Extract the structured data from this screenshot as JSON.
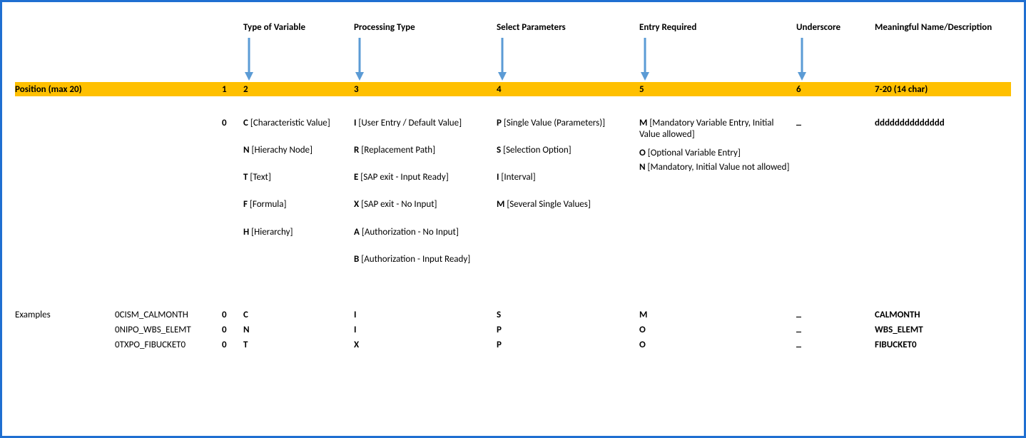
{
  "headers": {
    "type_of_variable": "Type of Variable",
    "processing_type": "Processing Type",
    "select_parameters": "Select Parameters",
    "entry_required": "Entry Required",
    "underscore": "Underscore",
    "meaningful_name": "Meaningful Name/Description"
  },
  "position_row": {
    "label": "Position (max 20)",
    "col1": "1",
    "col2": "2",
    "col3": "3",
    "col4": "4",
    "col5": "5",
    "col6": "6",
    "col7": "7-20 (14 char)"
  },
  "prefix_zero": "0",
  "type_of_variable": [
    {
      "code": "C",
      "desc": " [Characteristic Value]"
    },
    {
      "code": "N",
      "desc": " [Hierachy Node]"
    },
    {
      "code": "T",
      "desc": " [Text]"
    },
    {
      "code": "F",
      "desc": " [Formula]"
    },
    {
      "code": "H",
      "desc": " [Hierarchy]"
    }
  ],
  "processing_type": [
    {
      "code": "I",
      "desc": " [User Entry / Default Value]"
    },
    {
      "code": "R",
      "desc": " [Replacement Path]"
    },
    {
      "code": "E",
      "desc": " [SAP exit - Input Ready]"
    },
    {
      "code": "X",
      "desc": " [SAP exit - No Input]"
    },
    {
      "code": "A",
      "desc": " [Authorization - No Input]"
    },
    {
      "code": "B",
      "desc": " [Authorization - Input Ready]"
    }
  ],
  "select_parameters": [
    {
      "code": "P",
      "desc": " [Single Value (Parameters)]"
    },
    {
      "code": "S",
      "desc": " [Selection Option]"
    },
    {
      "code": "I",
      "desc": " [Interval]"
    },
    {
      "code": "M",
      "desc": " [Several Single Values]"
    }
  ],
  "entry_required": [
    {
      "code": "M",
      "desc": " [Mandatory Variable Entry, Initial Value allowed]"
    },
    {
      "code": "O",
      "desc": " [Optional Variable Entry]"
    },
    {
      "code": "N",
      "desc": " [Mandatory, Initial Value not allowed]"
    }
  ],
  "underscore_value": "_",
  "ddd": "dddddddddddddd",
  "examples_label": "Examples",
  "examples": [
    {
      "name": "0CISM_CALMONTH",
      "p1": "0",
      "p2": "C",
      "p3": "I",
      "p4": "S",
      "p5": "M",
      "p6": "_",
      "p7": "CALMONTH"
    },
    {
      "name": "0NIPO_WBS_ELEMT",
      "p1": "0",
      "p2": "N",
      "p3": "I",
      "p4": "P",
      "p5": "O",
      "p6": "_",
      "p7": "WBS_ELEMT"
    },
    {
      "name": "0TXPO_FIBUCKET0",
      "p1": "0",
      "p2": "T",
      "p3": "X",
      "p4": "P",
      "p5": "O",
      "p6": "_",
      "p7": "FIBUCKET0"
    }
  ]
}
